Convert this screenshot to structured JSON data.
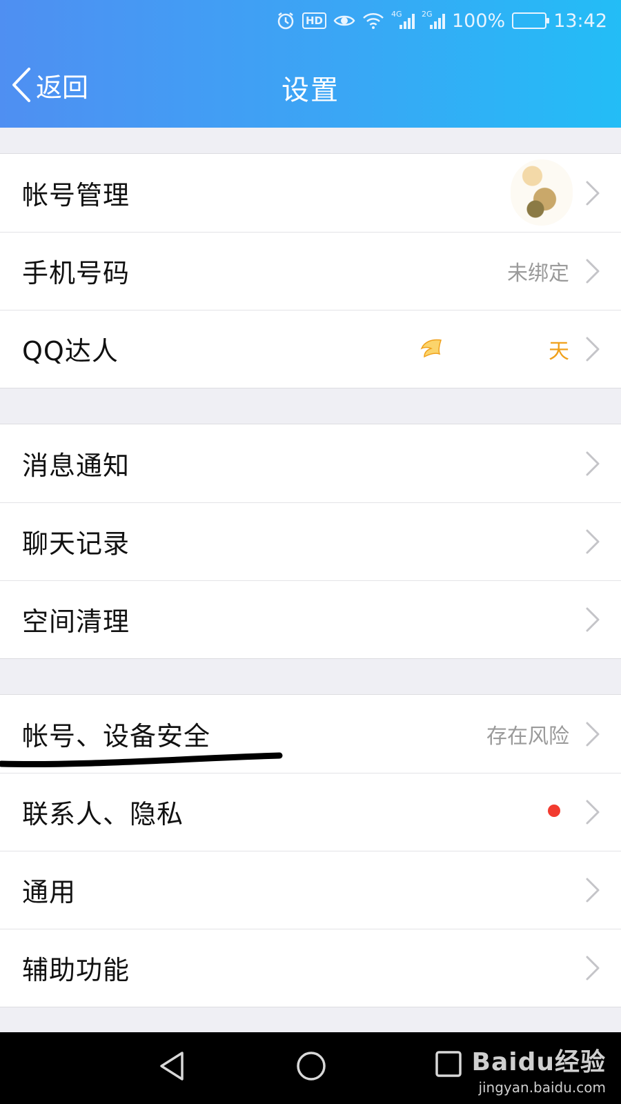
{
  "status_bar": {
    "battery": "100%",
    "time": "13:42",
    "hd_label": "HD",
    "sim1_tag": "4G",
    "sim2_tag": "2G",
    "icons": [
      "alarm-icon",
      "hd-icon",
      "eye-icon",
      "wifi-icon",
      "signal-icon",
      "signal-icon",
      "battery-icon"
    ]
  },
  "header": {
    "back_label": "返回",
    "title": "设置"
  },
  "groups": [
    {
      "items": [
        {
          "label": "帐号管理",
          "value": ""
        },
        {
          "label": "手机号码",
          "value": "未绑定"
        },
        {
          "label": "QQ达人",
          "value": "天"
        }
      ]
    },
    {
      "items": [
        {
          "label": "消息通知",
          "value": ""
        },
        {
          "label": "聊天记录",
          "value": ""
        },
        {
          "label": "空间清理",
          "value": ""
        }
      ]
    },
    {
      "items": [
        {
          "label": "帐号、设备安全",
          "value": "存在风险"
        },
        {
          "label": "联系人、隐私",
          "value": ""
        },
        {
          "label": "通用",
          "value": ""
        },
        {
          "label": "辅助功能",
          "value": ""
        }
      ]
    }
  ],
  "watermark": {
    "main": "Baidu经验",
    "sub": "jingyan.baidu.com"
  },
  "colors": {
    "header_start": "#4f8ff2",
    "header_end": "#23bdf6",
    "gold_value": "#f0a11c",
    "badge_red": "#f23b2f"
  }
}
